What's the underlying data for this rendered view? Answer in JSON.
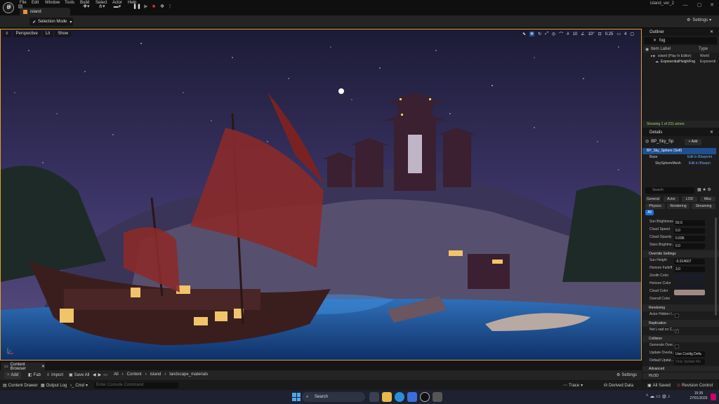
{
  "menu": {
    "items": [
      "File",
      "Edit",
      "Window",
      "Tools",
      "Build",
      "Select",
      "Actor",
      "Help"
    ]
  },
  "project_tab": "island",
  "project_name": "island_ver_2",
  "toolbar": {
    "selection_mode": "Selection Mode",
    "settings": "Settings"
  },
  "viewport": {
    "perspective": "Perspective",
    "lit": "Lit",
    "show": "Show",
    "grid_snap": "10",
    "rotation_snap": "10°",
    "scale_snap": "0.25",
    "camera_speed": "4"
  },
  "outliner": {
    "title": "Outliner",
    "search_value": "fog",
    "col_label": "Item Label",
    "col_type": "Type",
    "rows": [
      {
        "label": "island (Play In Editor)",
        "type": "World"
      },
      {
        "label": "ExponentialHeightFog",
        "type": "Exponenti"
      }
    ],
    "status": "Showing 1 of 231 actors"
  },
  "details": {
    "title": "Details",
    "actor_name": "BP_Sky_Sp",
    "add_label": "+ Add",
    "components": [
      {
        "label": "BP_Sky_Sphere (Self)",
        "link": ""
      },
      {
        "label": "Base",
        "link": "Edit in Blueprint"
      },
      {
        "label": "SkySphereMesh",
        "link": "Edit in Bluepri"
      }
    ],
    "search_placeholder": "Search",
    "categories": [
      "General",
      "Actor",
      "LOD",
      "Misc",
      "Physics",
      "Rendering",
      "Streaming",
      "All"
    ],
    "props1": [
      {
        "label": "Sun Brightness",
        "value": "50.0"
      },
      {
        "label": "Cloud Speed",
        "value": "0.0"
      },
      {
        "label": "Cloud Opacity",
        "value": "0.696"
      },
      {
        "label": "Stars Brightne...",
        "value": "0.0"
      }
    ],
    "section_override": "Override Settings",
    "props2": [
      {
        "label": "Sun Height",
        "value": "-0.914607"
      },
      {
        "label": "Horizon Falloff",
        "value": "3.0"
      }
    ],
    "colors": [
      {
        "label": "Zenith Color",
        "color": "#1a1c2a"
      },
      {
        "label": "Horizon Color",
        "color": "#181a24"
      },
      {
        "label": "Cloud Color",
        "color": "#a08a88"
      },
      {
        "label": "Overall Color",
        "color": "#1b1b22"
      }
    ],
    "section_rendering": "Rendering",
    "actor_hidden": "Actor Hidden I...",
    "section_replication": "Replication",
    "net_load": "Net Load on C...",
    "section_collision": "Collision",
    "generate_over": "Generate Over...",
    "update_overlaps": "Update Overla...",
    "update_overlaps_value": "Use Config Defa",
    "default_update": "Default Updat...",
    "default_update_value": "Only Update Mo",
    "section_advanced": "Advanced",
    "section_hlod": "HLOD"
  },
  "content_browser": {
    "tab": "Content Browser",
    "add": "Add",
    "fab": "Fab",
    "import": "Import",
    "save_all": "Save All",
    "breadcrumb": [
      "All",
      "Content",
      "island",
      "landscape_materials"
    ],
    "settings": "Settings"
  },
  "statusbar": {
    "content_drawer": "Content Drawer",
    "output_log": "Output Log",
    "cmd": "Cmd",
    "console_placeholder": "Enter Console Command",
    "trace": "Trace",
    "derived_data": "Derived Data",
    "all_saved": "All Saved",
    "revision_control": "Revision Control"
  },
  "taskbar": {
    "search": "Search",
    "time": "15:35",
    "date": "27/01/2025"
  },
  "colors": {
    "accent": "#e3a12a",
    "selection": "#1f4f8f",
    "status_green": "#9fd46a"
  }
}
